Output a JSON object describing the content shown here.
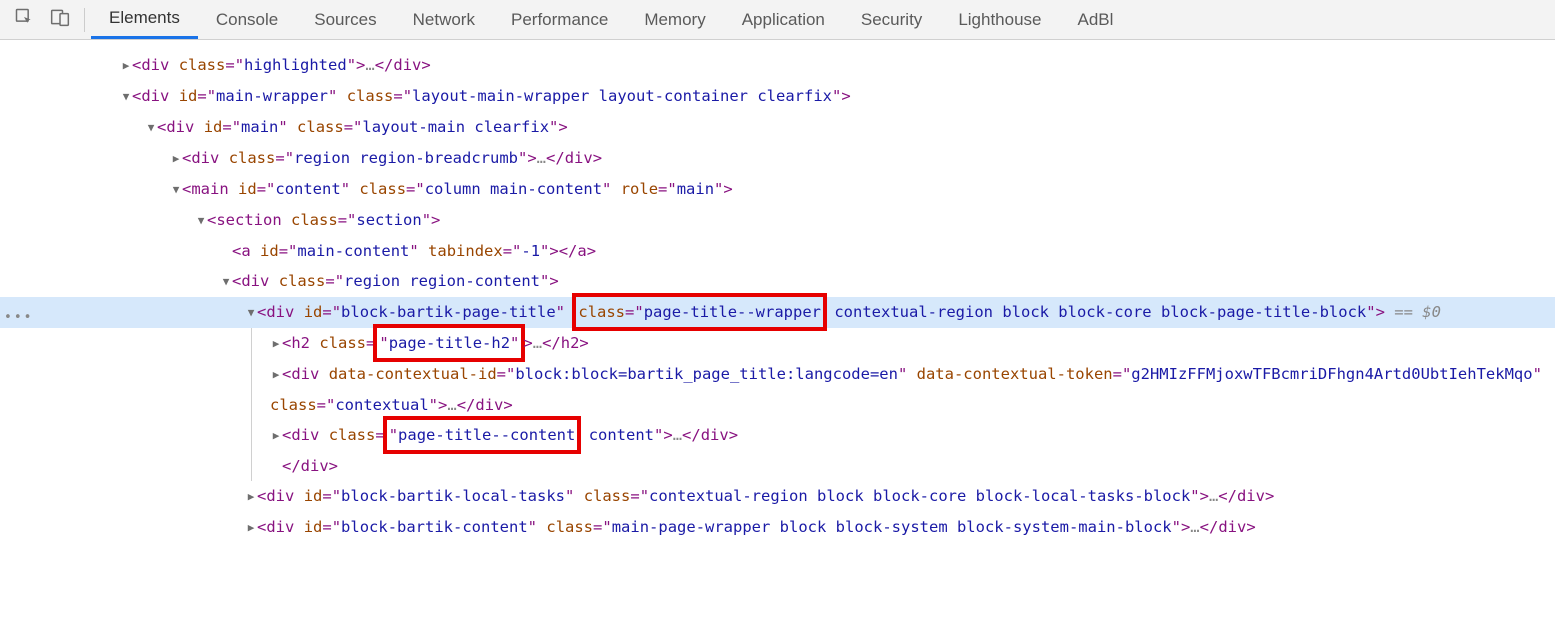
{
  "toolbar": {
    "tabs": [
      "Elements",
      "Console",
      "Sources",
      "Network",
      "Performance",
      "Memory",
      "Application",
      "Security",
      "Lighthouse",
      "AdBl"
    ],
    "active": 0
  },
  "dom": {
    "l1": {
      "tag": "div",
      "attr": "class",
      "val": "highlighted",
      "close": "div"
    },
    "l2": {
      "tag": "div",
      "id_attr": "id",
      "id_val": "main-wrapper",
      "cls_attr": "class",
      "cls_val": "layout-main-wrapper layout-container clearfix"
    },
    "l3": {
      "tag": "div",
      "id_attr": "id",
      "id_val": "main",
      "cls_attr": "class",
      "cls_val": "layout-main clearfix"
    },
    "l4": {
      "tag": "div",
      "cls_attr": "class",
      "cls_val": "region region-breadcrumb",
      "close": "div"
    },
    "l5": {
      "tag": "main",
      "id_attr": "id",
      "id_val": "content",
      "cls_attr": "class",
      "cls_val": "column main-content",
      "role_attr": "role",
      "role_val": "main"
    },
    "l6": {
      "tag": "section",
      "cls_attr": "class",
      "cls_val": "section"
    },
    "l7": {
      "tag": "a",
      "id_attr": "id",
      "id_val": "main-content",
      "tab_attr": "tabindex",
      "tab_val": "-1",
      "close": "a"
    },
    "l8": {
      "tag": "div",
      "cls_attr": "class",
      "cls_val": "region region-content"
    },
    "l9": {
      "tag": "div",
      "id_attr": "id",
      "id_val": "block-bartik-page-title",
      "cls_attr": "class",
      "cls_pre": "page-title--wrapper",
      "cls_rest": " contextual-region block block-core block-page-title-block",
      "selvar": " == $0"
    },
    "l10": {
      "tag": "h2",
      "cls_attr": "class",
      "cls_val": "page-title-h2",
      "close": "h2"
    },
    "l11": {
      "tag": "div",
      "a1": "data-contextual-id",
      "v1": "block:block=bartik_page_title:langcode=en",
      "a2": "data-contextual-token",
      "v2": "g2HMIzFFMjoxwTFBcmriDFhgn4Artd0UbtIehTekMqo",
      "a3": "class",
      "v3": "contextual",
      "close": "div"
    },
    "l12": {
      "tag": "div",
      "cls_attr": "class",
      "cls_pre": "page-title--content",
      "cls_rest": " content",
      "close": "div"
    },
    "l13": {
      "close": "div"
    },
    "l14": {
      "tag": "div",
      "id_attr": "id",
      "id_val": "block-bartik-local-tasks",
      "cls_attr": "class",
      "cls_val": "contextual-region block block-core block-local-tasks-block",
      "close": "div"
    },
    "l15": {
      "tag": "div",
      "id_attr": "id",
      "id_val": "block-bartik-content",
      "cls_attr": "class",
      "cls_val": "main-page-wrapper block block-system block-system-main-block",
      "close": "div"
    }
  }
}
